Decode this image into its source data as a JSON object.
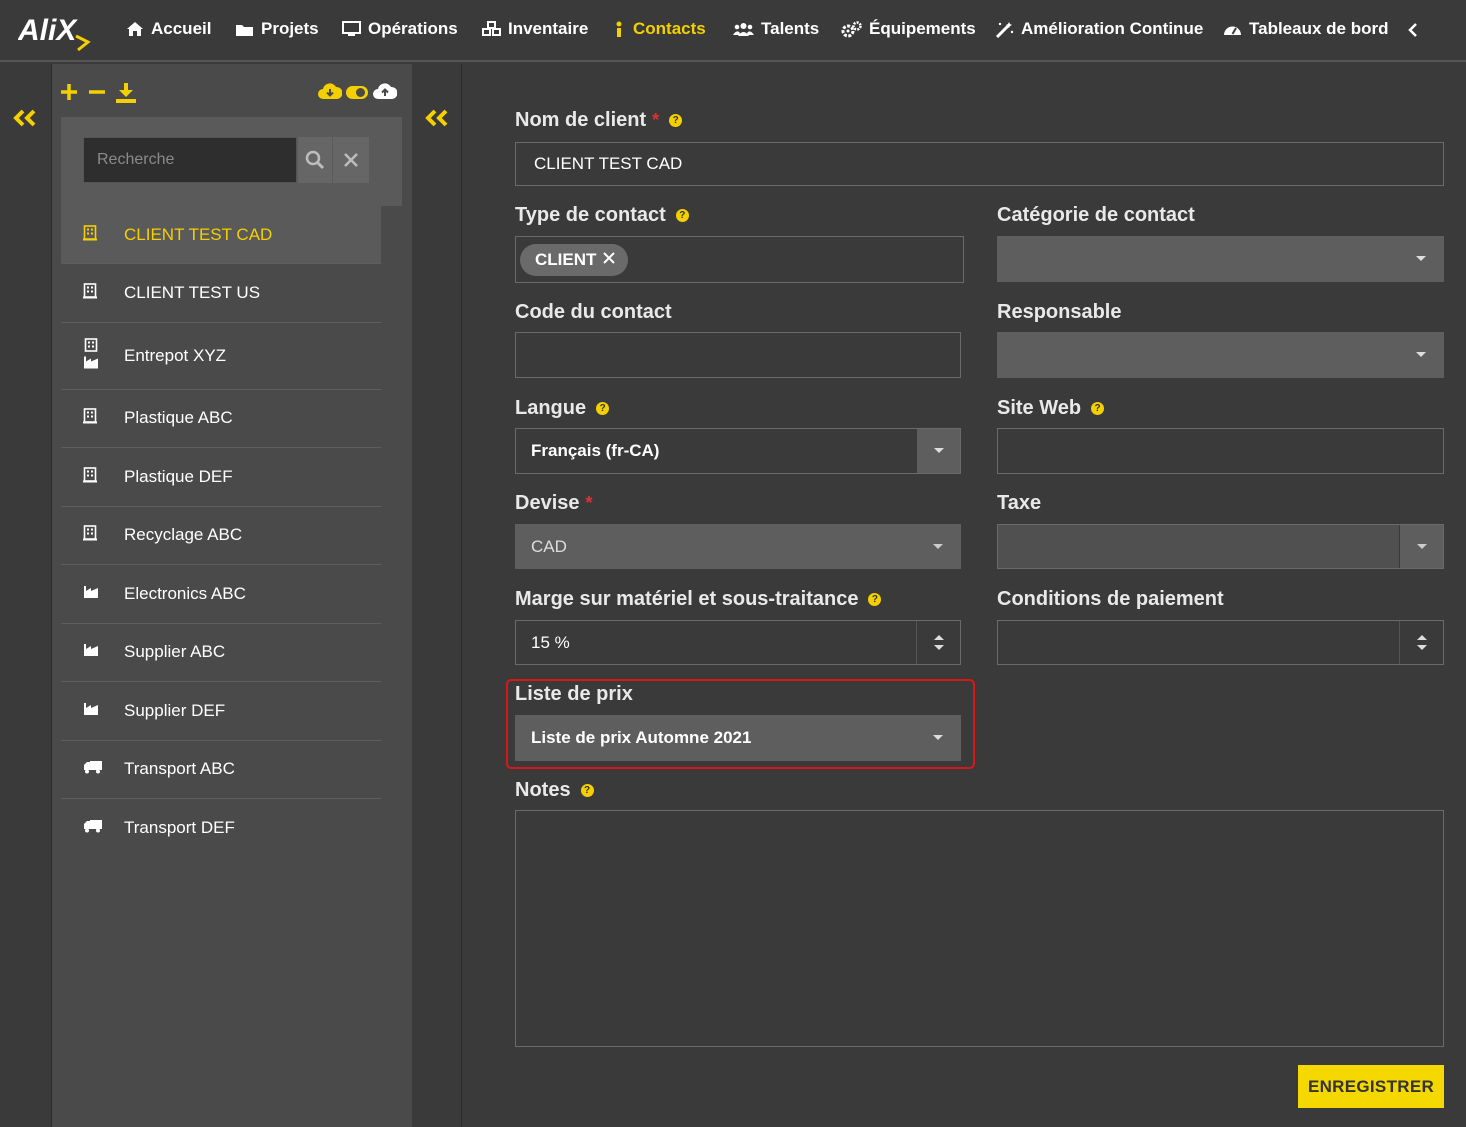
{
  "nav": {
    "items": [
      {
        "label": "Accueil",
        "icon": "home-icon"
      },
      {
        "label": "Projets",
        "icon": "folder-icon"
      },
      {
        "label": "Opérations",
        "icon": "monitor-icon"
      },
      {
        "label": "Inventaire",
        "icon": "cubes-icon"
      },
      {
        "label": "Contacts",
        "icon": "person-icon"
      },
      {
        "label": "Talents",
        "icon": "users-icon"
      },
      {
        "label": "Équipements",
        "icon": "gears-icon"
      },
      {
        "label": "Amélioration Continue",
        "icon": "magic-wand-icon"
      },
      {
        "label": "Tableaux de bord",
        "icon": "gauge-icon"
      }
    ],
    "active": "Contacts"
  },
  "search": {
    "placeholder": "Recherche"
  },
  "contacts": [
    {
      "name": "CLIENT TEST CAD",
      "icon": "building-icon"
    },
    {
      "name": "CLIENT TEST US",
      "icon": "building-icon"
    },
    {
      "name": "Entrepot XYZ",
      "icon": "building-factory-icon"
    },
    {
      "name": "Plastique ABC",
      "icon": "building-icon"
    },
    {
      "name": "Plastique DEF",
      "icon": "building-icon"
    },
    {
      "name": "Recyclage ABC",
      "icon": "building-icon"
    },
    {
      "name": "Electronics ABC",
      "icon": "factory-icon"
    },
    {
      "name": "Supplier ABC",
      "icon": "factory-icon"
    },
    {
      "name": "Supplier DEF",
      "icon": "factory-icon"
    },
    {
      "name": "Transport ABC",
      "icon": "truck-icon"
    },
    {
      "name": "Transport DEF",
      "icon": "truck-icon"
    }
  ],
  "form": {
    "client_name": {
      "label": "Nom de client",
      "value": "CLIENT TEST CAD"
    },
    "contact_type": {
      "label": "Type de contact",
      "chip": "CLIENT"
    },
    "contact_category": {
      "label": "Catégorie de contact",
      "value": ""
    },
    "contact_code": {
      "label": "Code du contact",
      "value": ""
    },
    "manager": {
      "label": "Responsable",
      "value": ""
    },
    "language": {
      "label": "Langue",
      "value": "Français (fr-CA)"
    },
    "website": {
      "label": "Site Web",
      "value": ""
    },
    "currency": {
      "label": "Devise",
      "value": "CAD"
    },
    "tax": {
      "label": "Taxe",
      "value": ""
    },
    "margin": {
      "label": "Marge sur matériel et sous-traitance",
      "value": "15 %"
    },
    "payment_terms": {
      "label": "Conditions de paiement",
      "value": ""
    },
    "price_list": {
      "label": "Liste de prix",
      "value": "Liste de prix Automne 2021"
    },
    "notes": {
      "label": "Notes",
      "value": ""
    },
    "save_label": "ENREGISTRER"
  },
  "colors": {
    "accent": "#f5d000",
    "required": "#dd3333",
    "highlight": "#d81818"
  }
}
